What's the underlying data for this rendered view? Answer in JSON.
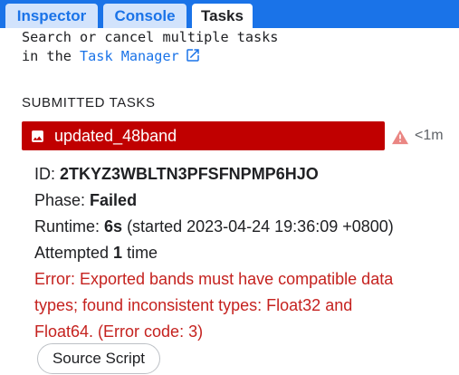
{
  "tabs": [
    {
      "label": "Inspector",
      "active": false
    },
    {
      "label": "Console",
      "active": false
    },
    {
      "label": "Tasks",
      "active": true
    }
  ],
  "intro": {
    "line1": "Search or cancel multiple tasks",
    "line2_prefix": "in the ",
    "link_label": "Task Manager",
    "link_icon": "open-in-new-icon"
  },
  "section_heading": "SUBMITTED TASKS",
  "task": {
    "name": "updated_48band",
    "icon": "image-icon",
    "status_icon": "warning-icon",
    "age": "<1m",
    "status_color": "#c00000",
    "details": {
      "id_label": "ID: ",
      "id_value": "2TKYZ3WBLTN3PFSFNPMP6HJO",
      "phase_label": "Phase: ",
      "phase_value": "Failed",
      "runtime_label": "Runtime: ",
      "runtime_value": "6s",
      "runtime_started": " (started 2023-04-24 19:36:09 +0800)",
      "attempted_prefix": "Attempted ",
      "attempted_count": "1",
      "attempted_suffix": " time",
      "error_line1": "Error: Exported bands must have compatible data",
      "error_line2": "types; found inconsistent types: Float32 and",
      "error_line3": "Float64. (Error code: 3)"
    },
    "source_button_label": "Source Script"
  },
  "colors": {
    "accent": "#1a73e8",
    "tab_inactive_bg": "#d2e3fc",
    "error_text": "#c5221f",
    "warning": "#ea8683"
  }
}
